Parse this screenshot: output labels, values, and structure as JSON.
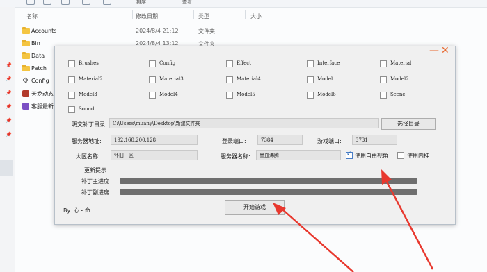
{
  "explorer": {
    "toolbar": {
      "sort_label": "排序",
      "view_label": "查看"
    },
    "columns": {
      "name": "名称",
      "modified": "修改日期",
      "type": "类型",
      "size": "大小"
    },
    "rows": [
      {
        "name": "Accounts",
        "date": "2024/8/4 21:12",
        "type": "文件夹",
        "icon": "folder-icon"
      },
      {
        "name": "Bin",
        "date": "2024/8/4 13:12",
        "type": "文件夹",
        "icon": "folder-icon"
      },
      {
        "name": "Data",
        "date": "",
        "type": "",
        "icon": "folder-icon"
      },
      {
        "name": "Patch",
        "date": "",
        "type": "",
        "icon": "folder-icon"
      },
      {
        "name": "Config",
        "date": "",
        "type": "",
        "icon": "gear-icon"
      },
      {
        "name": "天龙动态",
        "date": "",
        "type": "",
        "icon": "app-icon"
      },
      {
        "name": "客服最新",
        "date": "",
        "type": "",
        "icon": "app-icon"
      }
    ]
  },
  "dialog": {
    "minimize": "—",
    "close": "✕",
    "checkboxes": [
      {
        "label": "Brushes",
        "checked": false
      },
      {
        "label": "Config",
        "checked": false
      },
      {
        "label": "Effect",
        "checked": false
      },
      {
        "label": "Interface",
        "checked": false
      },
      {
        "label": "Material",
        "checked": false
      },
      {
        "label": "Material2",
        "checked": false
      },
      {
        "label": "Material3",
        "checked": false
      },
      {
        "label": "Material4",
        "checked": false
      },
      {
        "label": "Model",
        "checked": false
      },
      {
        "label": "Model2",
        "checked": false
      },
      {
        "label": "Model3",
        "checked": false
      },
      {
        "label": "Model4",
        "checked": false
      },
      {
        "label": "Model5",
        "checked": false
      },
      {
        "label": "Model6",
        "checked": false
      },
      {
        "label": "Scene",
        "checked": false
      },
      {
        "label": "Sound",
        "checked": false
      }
    ],
    "patch_dir_label": "明文补丁目录:",
    "patch_dir_value": "C:\\Users\\muany\\Desktop\\新建文件夹",
    "select_dir_button": "选择目录",
    "server_addr_label": "服务器地址:",
    "server_addr_value": "192.168.200.128",
    "login_port_label": "登录端口:",
    "login_port_value": "7384",
    "game_port_label": "游戏端口:",
    "game_port_value": "3731",
    "region_label": "大区名称:",
    "region_value": "怀旧一区",
    "server_name_label": "服务器名称:",
    "server_name_value": "墨血沸腾",
    "free_view_label": "使用自由视角",
    "free_view_checked": true,
    "plugin_label": "使用内挂",
    "plugin_checked": false,
    "update_tip_label": "更新提示",
    "main_progress_label": "补丁主进度",
    "sub_progress_label": "补丁副进度",
    "main_progress": 1.0,
    "sub_progress": 1.0,
    "start_button": "开始游戏",
    "author": "By: 心・命"
  },
  "colors": {
    "arrow": "#e8382e",
    "accent": "#e8662b",
    "progress": "#6f6f6f"
  }
}
